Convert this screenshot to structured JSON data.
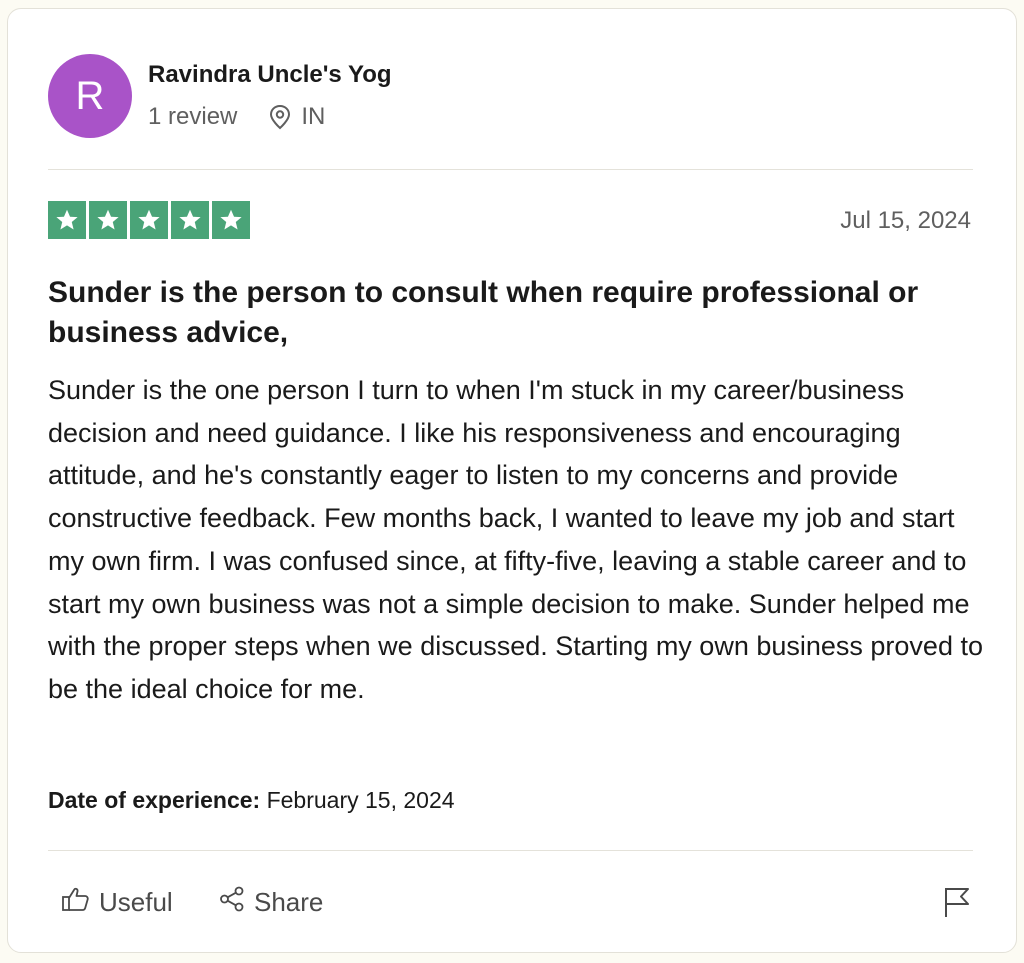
{
  "reviewer": {
    "initial": "R",
    "name": "Ravindra Uncle's Yog",
    "review_count": "1 review",
    "country": "IN",
    "avatar_color": "#a953c8"
  },
  "review": {
    "rating": 5,
    "rating_color": "#4aa478",
    "date": "Jul 15, 2024",
    "title": "Sunder is the person to consult when require professional or business advice,",
    "body": "Sunder is the one person I turn to when I'm stuck in my career/business decision and need guidance. I like his responsiveness and encouraging attitude, and he's constantly eager to listen to my concerns and provide constructive feedback. Few months back, I wanted to leave my job and start my own firm. I was confused since, at fifty-five, leaving a stable career and to start my own business was not a simple decision to make. Sunder helped me with the proper steps when we discussed. Starting my own business proved to be the ideal choice for me.",
    "experience_label": "Date of experience:",
    "experience_date": "February 15, 2024"
  },
  "actions": {
    "useful_label": "Useful",
    "share_label": "Share"
  },
  "icons": {
    "location": "location-pin-icon",
    "star": "star-icon",
    "useful": "thumbs-up-icon",
    "share": "share-icon",
    "report": "flag-icon"
  }
}
